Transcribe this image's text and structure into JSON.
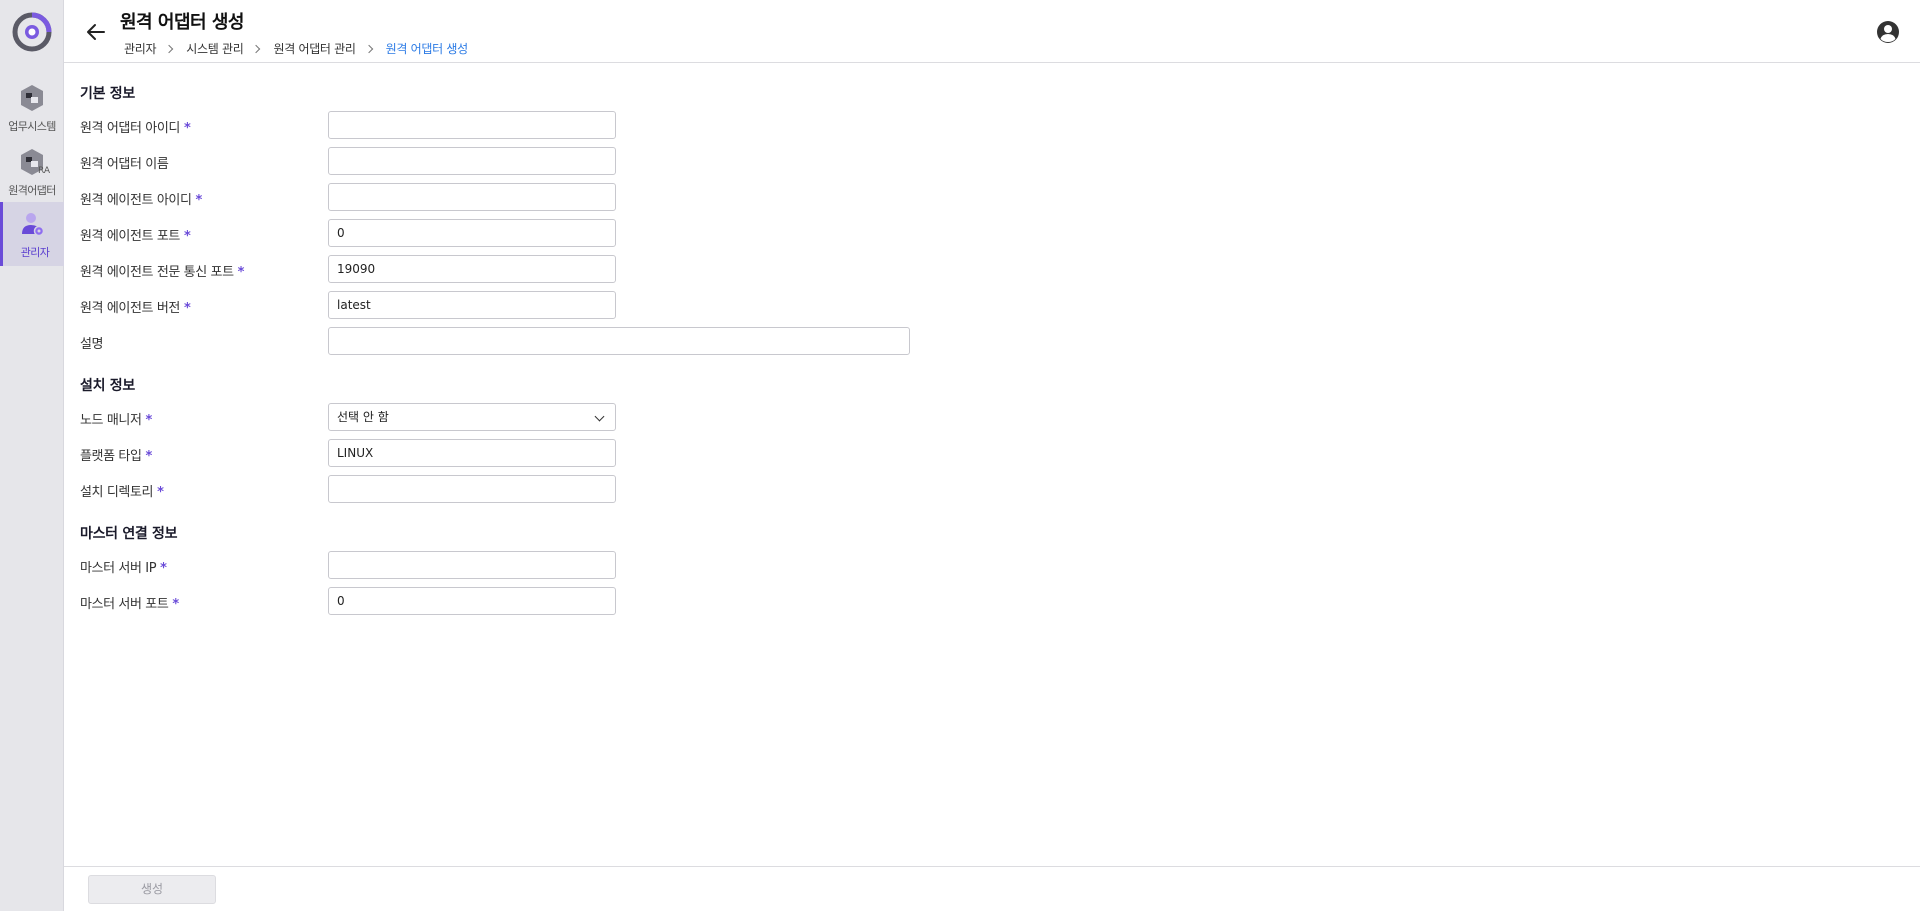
{
  "sidebar": {
    "items": [
      {
        "label": "업무시스템",
        "icon": "business-system-icon"
      },
      {
        "label": "원격어댑터",
        "icon": "remote-adapter-icon",
        "badge": "RA"
      },
      {
        "label": "관리자",
        "icon": "admin-user-icon",
        "active": true
      }
    ]
  },
  "header": {
    "title": "원격 어댑터 생성",
    "breadcrumb": [
      "관리자",
      "시스템 관리",
      "원격 어댑터 관리",
      "원격 어댑터 생성"
    ]
  },
  "form": {
    "basic": {
      "title": "기본 정보",
      "fields": [
        {
          "label": "원격 어댑터 아이디",
          "required": true,
          "value": ""
        },
        {
          "label": "원격 어댑터 이름",
          "required": false,
          "value": ""
        },
        {
          "label": "원격 에이전트 아이디",
          "required": true,
          "value": ""
        },
        {
          "label": "원격 에이전트 포트",
          "required": true,
          "value": "0"
        },
        {
          "label": "원격 에이전트 전문 통신 포트",
          "required": true,
          "value": "19090"
        },
        {
          "label": "원격 에이전트 버전",
          "required": true,
          "value": "latest"
        },
        {
          "label": "설명",
          "required": false,
          "value": ""
        }
      ]
    },
    "install": {
      "title": "설치 정보",
      "fields": [
        {
          "label": "노드 매니저",
          "required": true,
          "value": "선택 안 함"
        },
        {
          "label": "플랫폼 타입",
          "required": true,
          "value": "LINUX"
        },
        {
          "label": "설치 디렉토리",
          "required": true,
          "value": ""
        }
      ]
    },
    "master": {
      "title": "마스터 연결 정보",
      "fields": [
        {
          "label": "마스터 서버 IP",
          "required": true,
          "value": ""
        },
        {
          "label": "마스터 서버 포트",
          "required": true,
          "value": "0"
        }
      ]
    },
    "required_mark": "*"
  },
  "footer": {
    "create_label": "생성"
  },
  "colors": {
    "accent": "#6a4bd8",
    "breadcrumb_current": "#2c7be5"
  }
}
